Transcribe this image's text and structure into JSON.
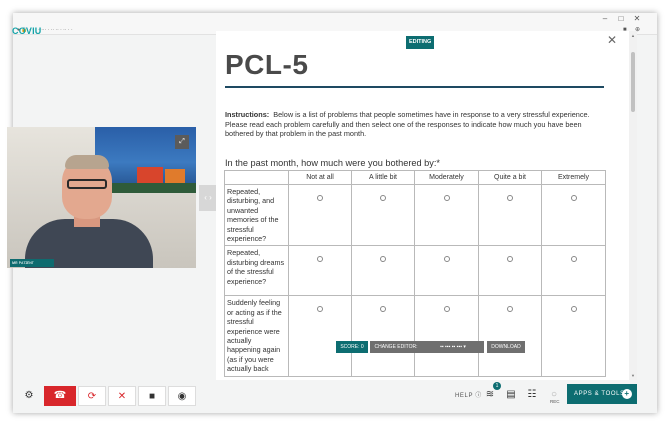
{
  "browser": {
    "window_controls": [
      "–",
      "□",
      "✕"
    ],
    "address_text": "● 🔒  · · · ·  ··· ·  ·· ·· ·  ·· · ·"
  },
  "app": {
    "logo": "COVIU"
  },
  "video": {
    "participant_label": "ᴍʀ ᴘᴀᴛɪᴇɴᴛ"
  },
  "form": {
    "status_badge": "EDITING",
    "title": "PCL-5",
    "instructions_label": "Instructions:",
    "instructions_text": "Below is a list of problems that people sometimes have in response to a very stressful experience. Please read each problem carefully and then select one of the responses to indicate how much you have been bothered by that problem in the past month.",
    "question": "In the past month, how much were you bothered by:*",
    "columns": [
      "Not at all",
      "A little bit",
      "Moderately",
      "Quite a bit",
      "Extremely"
    ],
    "rows": [
      "Repeated, disturbing, and unwanted memories of the stressful experience?",
      "Repeated, disturbing dreams of the stressful experience?",
      "Suddenly feeling or acting as if the stressful experience were actually happening again (as if you were actually back"
    ]
  },
  "float_toolbar": {
    "score": "SCORE: 0",
    "change_editor": "CHANGE EDITOR:",
    "editor_value": "▪▪ ▪▪▪ ▪▪ ▪▪▪ ▾",
    "download": "DOWNLOAD"
  },
  "bottom_bar": {
    "help": "HELP",
    "notification_count": "1",
    "rec": "REC",
    "apps_tools": "APPS & TOOLS",
    "apps_plus": "+"
  },
  "colors": {
    "brand_teal": "#0d6d71",
    "logo_teal": "#13a3a8",
    "hangup_red": "#d8262b",
    "title_rule": "#1e4a62"
  }
}
